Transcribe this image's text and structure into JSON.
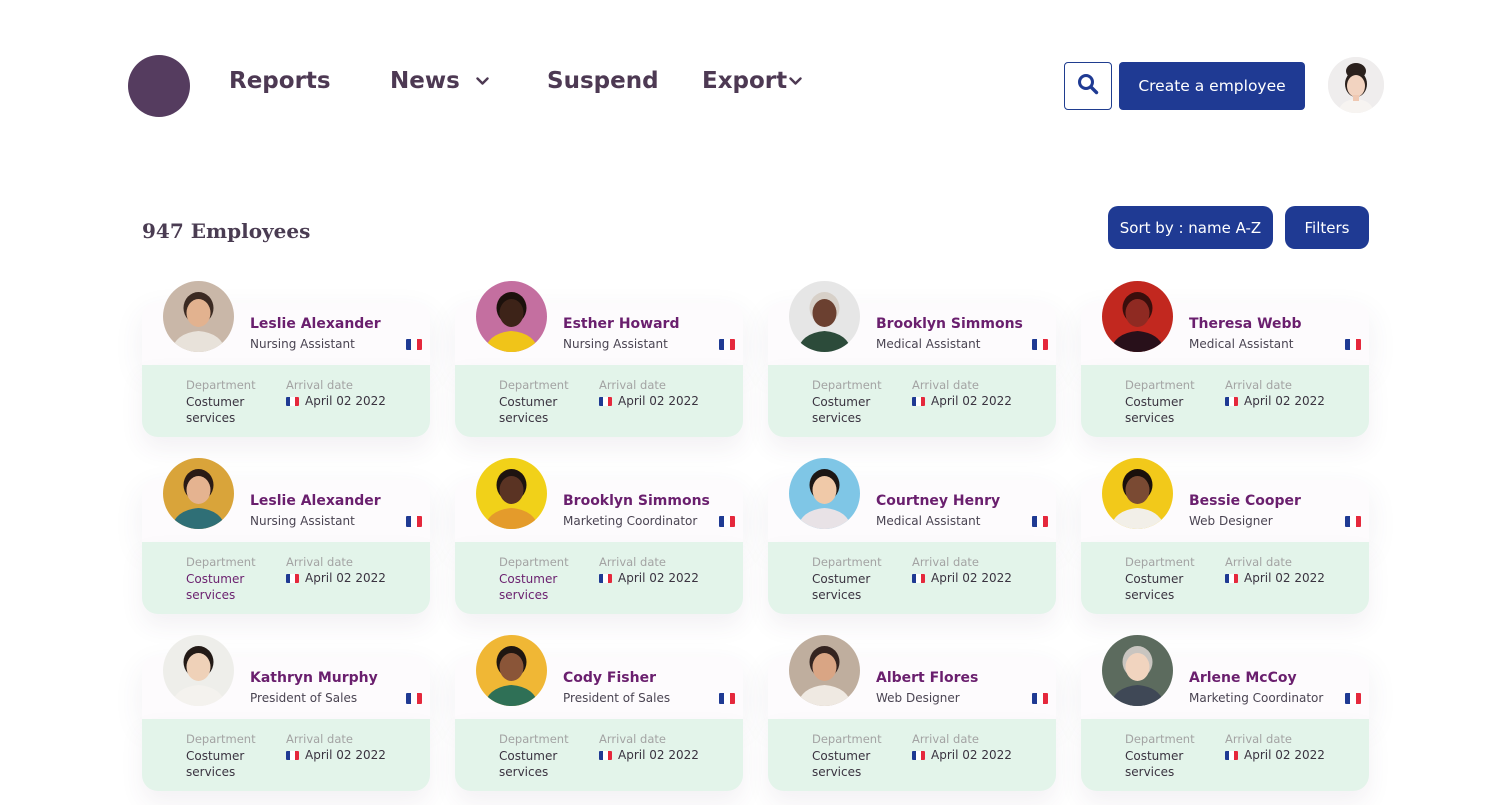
{
  "nav": {
    "items": [
      {
        "label": "Reports",
        "dropdown": false
      },
      {
        "label": "News",
        "dropdown": true
      },
      {
        "label": "Suspend",
        "dropdown": false
      },
      {
        "label": "Export",
        "dropdown": true
      }
    ]
  },
  "header": {
    "create_label": "Create a employee",
    "search_icon": "search-icon",
    "user_avatar": "user-avatar"
  },
  "toolbar": {
    "count_title": "947 Employees",
    "sort_label": "Sort by : name A-Z",
    "filters_label": "Filters"
  },
  "colors": {
    "brand": "#553c5f",
    "primary_button": "#1f3a93",
    "name_accent": "#6a1f6e",
    "card_bottom": "#e3f4ea",
    "flag_blue": "#1f3a93",
    "flag_white": "#ffffff",
    "flag_red": "#e5283c"
  },
  "employees": [
    {
      "name": "Leslie Alexander",
      "role": "Nursing Assistant",
      "department_label": "Department",
      "department": "Costumer services",
      "arrival_label": "Arrival date",
      "arrival": "April 02 2022",
      "dept_accent": false,
      "avatar_bg": "#c9b7a8",
      "skin": "#e2b28f",
      "hair": "#3b2a22",
      "shirt": "#e8e2da"
    },
    {
      "name": "Esther Howard",
      "role": "Nursing Assistant",
      "department_label": "Department",
      "department": "Costumer services",
      "arrival_label": "Arrival date",
      "arrival": "April 02 2022",
      "dept_accent": false,
      "avatar_bg": "#c46fa0",
      "skin": "#3d2318",
      "hair": "#1c110c",
      "shirt": "#f0c419"
    },
    {
      "name": "Brooklyn Simmons",
      "role": "Medical Assistant",
      "department_label": "Department",
      "department": "Costumer services",
      "arrival_label": "Arrival date",
      "arrival": "April 02 2022",
      "dept_accent": false,
      "avatar_bg": "#e6e6e6",
      "skin": "#6b4030",
      "hair": "#d7d0c8",
      "shirt": "#2c4b3a"
    },
    {
      "name": "Theresa Webb",
      "role": "Medical Assistant",
      "department_label": "Department",
      "department": "Costumer services",
      "arrival_label": "Arrival date",
      "arrival": "April 02 2022",
      "dept_accent": false,
      "avatar_bg": "#c2281f",
      "skin": "#8f2a22",
      "hair": "#3a0e0c",
      "shirt": "#28101a"
    },
    {
      "name": "Leslie Alexander",
      "role": "Nursing Assistant",
      "department_label": "Department",
      "department": "Costumer services",
      "arrival_label": "Arrival date",
      "arrival": "April 02 2022",
      "dept_accent": true,
      "avatar_bg": "#d9a43a",
      "skin": "#e5b390",
      "hair": "#2a1b16",
      "shirt": "#2f6f76"
    },
    {
      "name": "Brooklyn Simmons",
      "role": "Marketing Coordinator",
      "department_label": "Department",
      "department": "Costumer services",
      "arrival_label": "Arrival date",
      "arrival": "April 02 2022",
      "dept_accent": true,
      "avatar_bg": "#f1d119",
      "skin": "#5a3323",
      "hair": "#1d1310",
      "shirt": "#e49b2b"
    },
    {
      "name": "Courtney Henry",
      "role": "Medical Assistant",
      "department_label": "Department",
      "department": "Costumer services",
      "arrival_label": "Arrival date",
      "arrival": "April 02 2022",
      "dept_accent": false,
      "avatar_bg": "#7fc6e6",
      "skin": "#f0c9a8",
      "hair": "#1d1715",
      "shirt": "#e8e2e6"
    },
    {
      "name": "Bessie Cooper",
      "role": "Web Designer",
      "department_label": "Department",
      "department": "Costumer services",
      "arrival_label": "Arrival date",
      "arrival": "April 02 2022",
      "dept_accent": false,
      "avatar_bg": "#f2c91a",
      "skin": "#7a4a33",
      "hair": "#1a100c",
      "shirt": "#f2efe8"
    },
    {
      "name": "Kathryn Murphy",
      "role": "President of Sales",
      "department_label": "Department",
      "department": "Costumer services",
      "arrival_label": "Arrival date",
      "arrival": "April 02 2022",
      "dept_accent": false,
      "avatar_bg": "#eeeeea",
      "skin": "#efd1b8",
      "hair": "#231a16",
      "shirt": "#f4f2ee"
    },
    {
      "name": "Cody Fisher",
      "role": "President of Sales",
      "department_label": "Department",
      "department": "Costumer services",
      "arrival_label": "Arrival date",
      "arrival": "April 02 2022",
      "dept_accent": false,
      "avatar_bg": "#f0b735",
      "skin": "#8a5538",
      "hair": "#1f1611",
      "shirt": "#2f7056"
    },
    {
      "name": "Albert Flores",
      "role": "Web Designer",
      "department_label": "Department",
      "department": "Costumer services",
      "arrival_label": "Arrival date",
      "arrival": "April 02 2022",
      "dept_accent": false,
      "avatar_bg": "#bfae9e",
      "skin": "#d9a584",
      "hair": "#342420",
      "shirt": "#efe9e2"
    },
    {
      "name": "Arlene McCoy",
      "role": "Marketing Coordinator",
      "department_label": "Department",
      "department": "Costumer services",
      "arrival_label": "Arrival date",
      "arrival": "April 02 2022",
      "dept_accent": false,
      "avatar_bg": "#5c6b5e",
      "skin": "#f1d4bf",
      "hair": "#c9c5c0",
      "shirt": "#3f4856"
    }
  ]
}
